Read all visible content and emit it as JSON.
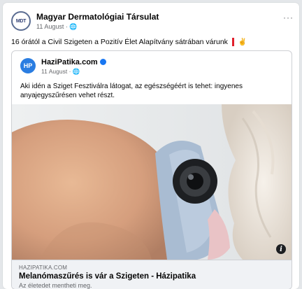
{
  "post": {
    "author": "Magyar Dermatológiai Társulat",
    "avatar_text": "MDT",
    "date": "11 August",
    "audience_icon": "globe-icon",
    "text": "16 órától a Civil Szigeten a Pozitív Élet Alapítvány sátrában várunk",
    "emoji_hand": "✌"
  },
  "shared": {
    "author": "HaziPatika.com",
    "avatar_text": "HP",
    "date": "11 August",
    "text": "Aki idén a Sziget Fesztiválra látogat, az egészségéért is tehet: ingyenes anyajegyszűrésen vehet részt.",
    "link": {
      "domain": "HAZIPATIKA.COM",
      "title": "Melanómaszűrés is vár a Szigeten - Házipatika",
      "description": "Az életedet mentheti meg."
    },
    "info_label": "i"
  },
  "menu": {
    "more_label": "···"
  },
  "colors": {
    "accent": "#1877f2",
    "pin": "#e0202c"
  }
}
